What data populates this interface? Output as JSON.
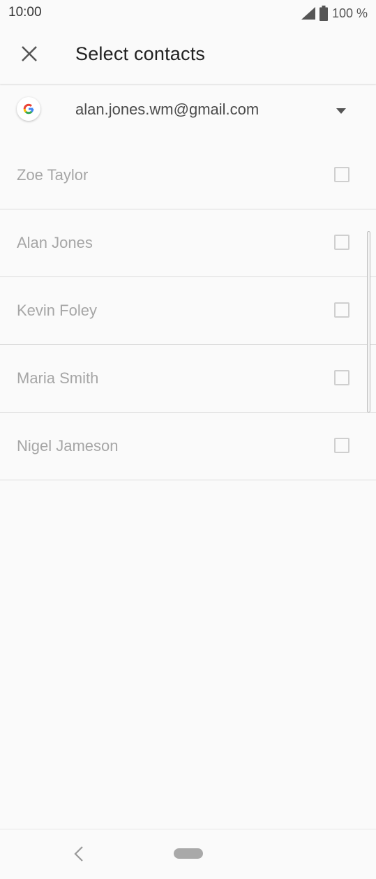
{
  "status_bar": {
    "time": "10:00",
    "battery_text": "100 %",
    "signal_icon": "signal-icon",
    "battery_icon": "battery-icon"
  },
  "app_bar": {
    "title": "Select contacts",
    "close_icon": "close-icon"
  },
  "account": {
    "email": "alan.jones.wm@gmail.com",
    "logo_icon": "google-logo-icon",
    "dropdown_icon": "dropdown-arrow-icon"
  },
  "contacts": [
    {
      "name": "Zoe Taylor",
      "checked": false
    },
    {
      "name": "Alan Jones",
      "checked": false
    },
    {
      "name": "Kevin Foley",
      "checked": false
    },
    {
      "name": "Maria Smith",
      "checked": false
    },
    {
      "name": "Nigel Jameson",
      "checked": false
    }
  ],
  "nav_bar": {
    "back_icon": "back-icon",
    "home_icon": "home-pill-icon"
  },
  "colors": {
    "background": "#fafafa",
    "contact_text": "#a6a6a6",
    "checkbox_border": "#cfcfcf",
    "title_text": "#212121"
  }
}
